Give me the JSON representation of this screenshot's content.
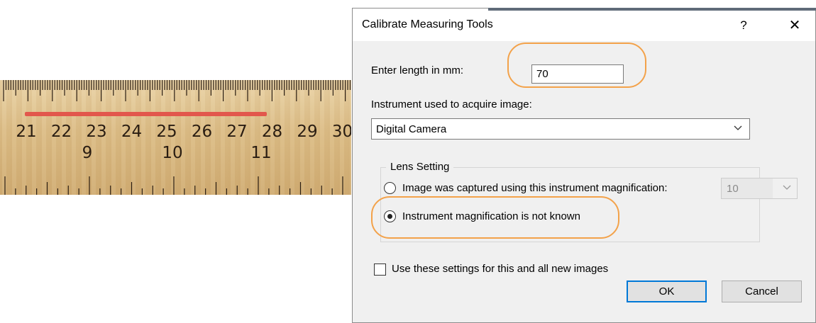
{
  "ruler": {
    "cm_labels": [
      "21",
      "22",
      "23",
      "24",
      "25",
      "26",
      "27",
      "28",
      "29",
      "30"
    ],
    "inch_labels": [
      "9",
      "10",
      "11"
    ],
    "measure_color": "#e2574c"
  },
  "dialog": {
    "title": "Calibrate Measuring Tools",
    "help_label": "?",
    "close_label": "✕",
    "length_label": "Enter length in mm:",
    "length_value": "70",
    "instrument_label": "Instrument used to acquire image:",
    "instrument_selected": "Digital Camera",
    "lens_group_title": "Lens Setting",
    "radio_known_label": "Image was captured using this instrument magnification:",
    "radio_known_checked": false,
    "magnification_value": "10",
    "radio_unknown_label": "Instrument magnification is not known",
    "radio_unknown_checked": true,
    "checkbox_label": "Use these settings for this and all new images",
    "checkbox_checked": false,
    "ok_label": "OK",
    "cancel_label": "Cancel"
  },
  "colors": {
    "highlight": "#f3a24a",
    "default_button_border": "#0078d7"
  }
}
